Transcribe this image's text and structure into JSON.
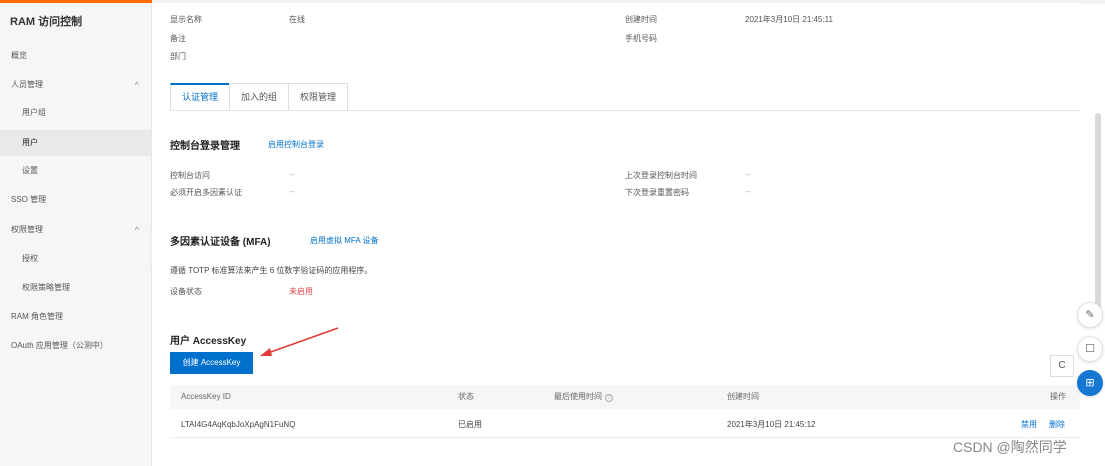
{
  "sidebar": {
    "title": "RAM 访问控制",
    "items": [
      {
        "label": "概览"
      },
      {
        "label": "人员管理",
        "chevron": "^"
      },
      {
        "label": "用户组"
      },
      {
        "label": "用户"
      },
      {
        "label": "设置"
      },
      {
        "label": "SSO 管理"
      },
      {
        "label": "权限管理",
        "chevron": "^"
      },
      {
        "label": "授权"
      },
      {
        "label": "权限策略管理"
      },
      {
        "label": "RAM 角色管理"
      },
      {
        "label": "OAuth 应用管理（公测中）"
      }
    ],
    "collapse_icon": "‹"
  },
  "info": {
    "display_name_label": "显示名称",
    "display_name_value": "在线",
    "remark_label": "备注",
    "department_label": "部门",
    "created_label": "创建时间",
    "created_value": "2021年3月10日 21:45:11",
    "phone_label": "手机号码"
  },
  "tabs": [
    "认证管理",
    "加入的组",
    "权限管理"
  ],
  "console": {
    "title": "控制台登录管理",
    "enable_link": "启用控制台登录",
    "access_label": "控制台访问",
    "access_value": "--",
    "mfa_required_label": "必须开启多因素认证",
    "mfa_required_value": "--",
    "last_login_label": "上次登录控制台时间",
    "last_login_value": "--",
    "reset_pwd_label": "下次登录重置密码",
    "reset_pwd_value": "--"
  },
  "mfa": {
    "title": "多因素认证设备 (MFA)",
    "enable_link": "启用虚拟 MFA 设备",
    "desc": "遵循 TOTP 标准算法来产生 6 位数字验证码的应用程序。",
    "status_label": "设备状态",
    "status_value": "未启用"
  },
  "accesskey": {
    "title": "用户 AccessKey",
    "create_button": "创建 AccessKey",
    "refresh_icon": "C",
    "columns": [
      "AccessKey ID",
      "状态",
      "最后使用时间",
      "创建时间",
      "操作"
    ],
    "help_icon": "?",
    "rows": [
      {
        "id": "LTAI4G4AqKqbJoXpAgN1FuNQ",
        "status": "已启用",
        "last_used": "",
        "created": "2021年3月10日 21:45:12",
        "action_disable": "禁用",
        "action_delete": "删除"
      }
    ]
  },
  "colors": {
    "accent": "#0070cc",
    "brand": "#ff6a00",
    "danger": "#e04343",
    "arrow": "#e03b3b"
  },
  "float_buttons": [
    {
      "name": "edit-icon",
      "glyph": "✎"
    },
    {
      "name": "message-icon",
      "glyph": "☐"
    },
    {
      "name": "apps-icon",
      "glyph": "⊞"
    }
  ],
  "watermark": "CSDN @陶然同学"
}
